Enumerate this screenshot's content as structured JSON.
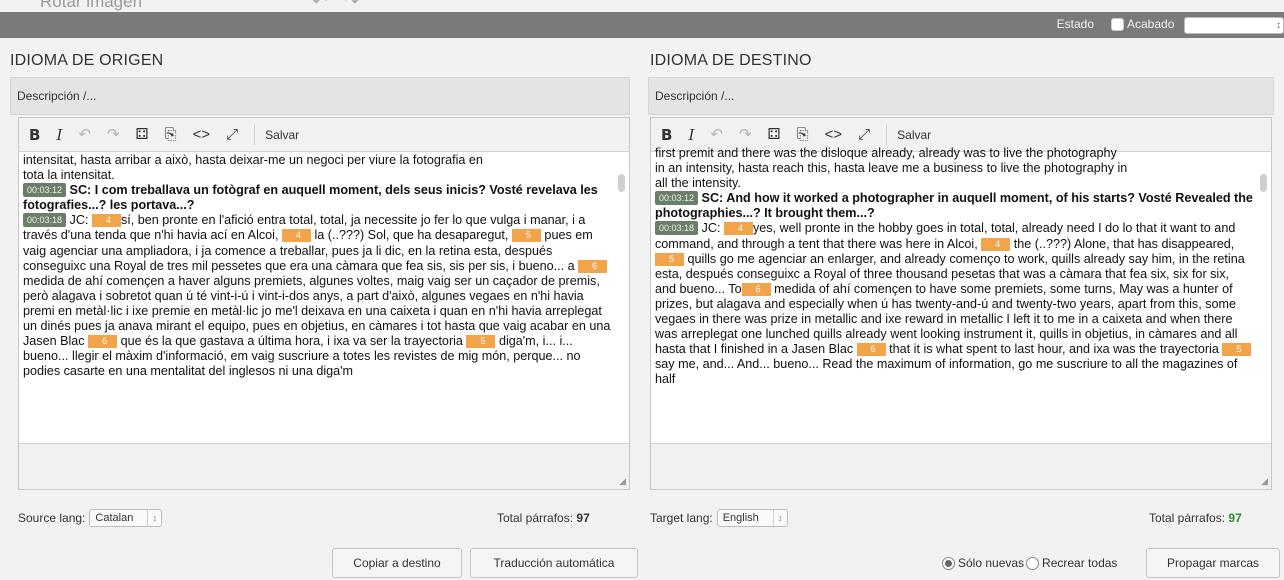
{
  "top_partial": {
    "label": "Rotar imagen",
    "arrows": "↶ ↷"
  },
  "status": {
    "estado_label": "Estado",
    "acabado_label": "Acabado",
    "acabado_checked": false,
    "select_value": ""
  },
  "source": {
    "title": "IDIOMA DE ORIGEN",
    "description": "Descripción /...",
    "toolbar": {
      "bold": "B",
      "italic": "I",
      "undo": "↶",
      "redo": "↷",
      "find": "⚃",
      "paste": "⎘",
      "code": "<>",
      "fullscreen": "⤢",
      "save": "Salvar"
    },
    "lines": [
      "intensitat, hasta arribar a això, hasta deixar-me un negoci per viure la fotografia en",
      "tota la intensitat."
    ],
    "sc_timestamp": "00:03:12",
    "sc_text": "SC: I com treballava un fotògraf en auquell moment, dels seus inicis? Vosté revelava les fotografies...? les portava...?",
    "jc_timestamp": "00:03:18",
    "jc_parts": [
      "JC: ",
      "sí, ben pronte en l'afició entra total, total, ja necessite jo fer lo que vulga i manar, i a través d'una tenda que n'hi havia ací en Alcoi, ",
      " la (..???) Sol, que ha desaparegut, ",
      " pues em vaig agenciar una ampliadora, i ja comence a treballar, pues ja li dic, en la retina esta, después conseguixc una Royal de tres mil pessetes que era una càmara que fea sis, sis per sis, i bueno... a ",
      " medida de ahí començen a haver alguns premiets, algunes voltes, maig vaig ser un caçador de premis, però alagava i sobretot quan ú té vint-i-ú i vint-i-dos anys, a part d'això, algunes vegaes en n'hi havia premi en metàl·lic i ixe premie en metàl·lic jo me'l deixava en una caixeta i quan en n'hi havia arreplegat un dinés pues ja anava mirant el equipo, pues en objetius, en càmares i tot hasta que vaig acabar en una Jasen Blac ",
      " que és la que gastava a última hora, i ixa va ser la trayectoria ",
      " diga'm, i... i... bueno... llegir el màxim d'informació, em vaig suscriure a totes les revistes de mig món, perque... no podies casarte en una mentalitat del inglesos ni una diga'm"
    ],
    "marks": [
      "4",
      "4",
      "5",
      "6",
      "6",
      "5"
    ],
    "lang_label": "Source lang:",
    "lang_value": "Catalan",
    "total_label": "Total párrafos:",
    "total_value": "97"
  },
  "target": {
    "title": "IDIOMA DE DESTINO",
    "description": "Descripción /...",
    "toolbar": {
      "bold": "B",
      "italic": "I",
      "undo": "↶",
      "redo": "↷",
      "find": "⚃",
      "paste": "⎘",
      "code": "<>",
      "fullscreen": "⤢",
      "save": "Salvar"
    },
    "lines": [
      "first premit and there was the disloque already, already was to live the photography",
      "in an intensity, hasta reach this, hasta leave me a business to live the photography in",
      "all the intensity."
    ],
    "sc_timestamp": "00:03:12",
    "sc_text": "SC: And how it worked a photographer in auquell moment, of his starts? Vosté Revealed the photographies...? It brought them...?",
    "jc_timestamp": "00:03:18",
    "jc_parts": [
      "JC: ",
      "yes, well pronte in the hobby goes in total, total, already need I do lo that it want to and command, and through a tent that there was here in Alcoi, ",
      " the (..???) Alone, that has disappeared, ",
      " quills go me agenciar an enlarger, and already començo to work, quills already say him, in the retina esta, después conseguixc a Royal of three thousand pesetas that was a càmara that fea six, six for six, and bueno... To",
      " medida of ahí començen to have some premiets, some turns, May was a hunter of prizes, but alagava and especially when ú has twenty-and-ú and twenty-two years, apart from this, some vegaes in there was prize in metallic and ixe reward in metallic I left it to me in a caixeta and when there was arreplegat one lunched quills already went looking instrument it, quills in objetius, in càmares and all hasta that I finished in a Jasen Blac ",
      " that it is what spent to last hour, and ixa was the trayectoria ",
      " say me, and... And... bueno... Read the maximum of information, go me suscriure to all the magazines of half"
    ],
    "marks": [
      "4",
      "4",
      "5",
      "6",
      "6",
      "5"
    ],
    "lang_label": "Target lang:",
    "lang_value": "English",
    "total_label": "Total párrafos:",
    "total_value": "97"
  },
  "buttons": {
    "copy": "Copiar a destino",
    "auto_translate": "Traducción automática",
    "propagate": "Propagar marcas"
  },
  "radio": {
    "only_new": "Sólo nuevas",
    "recreate_all": "Recrear todas",
    "selected": "only_new"
  },
  "colors": {
    "status_bar": "#7a7a7a",
    "timestamp": "#6b7e69",
    "mark": "#f2a44a",
    "total_green": "#2e8b2e"
  }
}
